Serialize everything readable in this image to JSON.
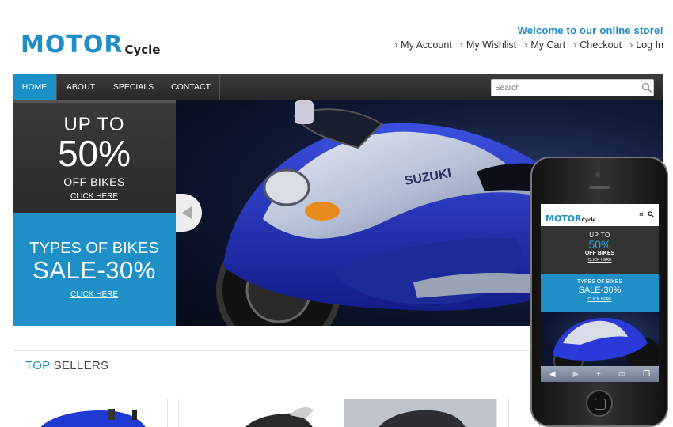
{
  "header": {
    "logo_motor": "MOTOR",
    "logo_cycle": "Cycle",
    "welcome": "Welcome to our online store!",
    "links": [
      "My Account",
      "My Wishlist",
      "My Cart",
      "Checkout",
      "Log In"
    ]
  },
  "nav": {
    "items": [
      "HOME",
      "ABOUT",
      "SPECIALS",
      "CONTACT"
    ],
    "active": "HOME",
    "search_placeholder": "Search"
  },
  "banner": {
    "promo1": {
      "line1": "UP TO",
      "line2": "50%",
      "line3": "OFF BIKES",
      "link": "CLICK HERE"
    },
    "promo2": {
      "line1": "TYPES OF BIKES",
      "line2": "SALE-30%",
      "link": "CLICK HERE"
    },
    "brand_text": "SUZUKI"
  },
  "sellers": {
    "title_part1": "TOP",
    "title_part2": "SELLERS"
  },
  "phone": {
    "logo_motor": "MOTOR",
    "logo_cycle": "Cycle",
    "promo1": {
      "line1": "UP TO",
      "line2": "50%",
      "line3": "OFF BIKES",
      "link": "CLICK HERE"
    },
    "promo2": {
      "line1": "TYPES OF BIKES",
      "line2": "SALE-30%",
      "link": "CLICK HERE"
    }
  },
  "colors": {
    "brand": "#1f8fc8",
    "nav_bg": "#2d2d2d",
    "promo_dark": "#333333"
  }
}
